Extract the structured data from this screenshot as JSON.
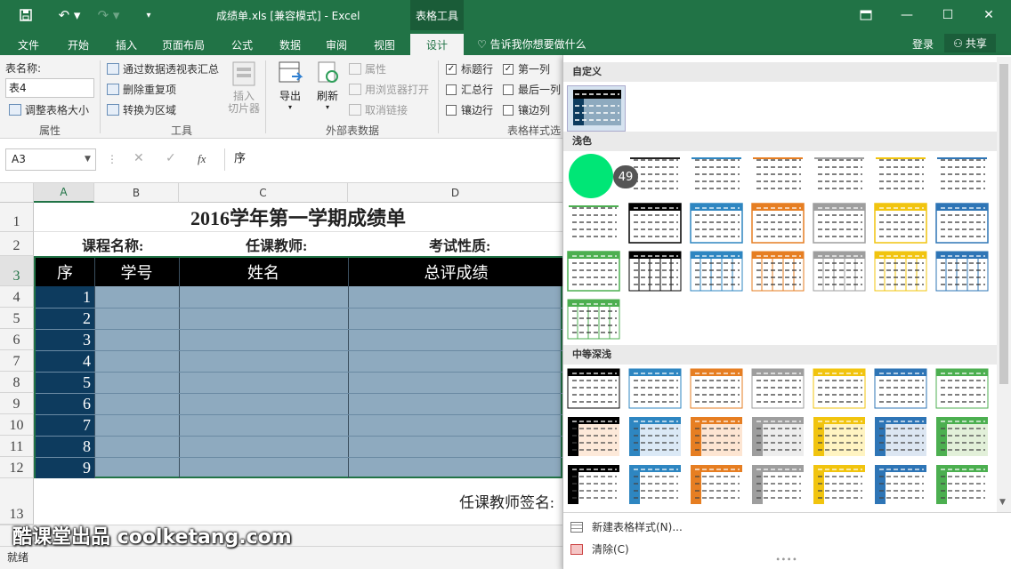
{
  "titlebar": {
    "title": "成绩单.xls  [兼容模式] - Excel",
    "context_tab": "表格工具",
    "share": "共享",
    "login": "登录"
  },
  "tabs": [
    "文件",
    "开始",
    "插入",
    "页面布局",
    "公式",
    "数据",
    "审阅",
    "视图",
    "设计"
  ],
  "tell_me": "告诉我你想要做什么",
  "ribbon": {
    "table_name_label": "表名称:",
    "table_name_value": "表4",
    "resize": "调整表格大小",
    "props_group": "属性",
    "pivot": "通过数据透视表汇总",
    "dedupe": "删除重复项",
    "convert": "转换为区域",
    "slicer": "插入\n切片器",
    "tools_group": "工具",
    "export": "导出",
    "refresh": "刷新",
    "properties": "属性",
    "open_browser": "用浏览器打开",
    "unlink": "取消链接",
    "external_group": "外部表数据",
    "header_row": "标题行",
    "first_col": "第一列",
    "total_row": "汇总行",
    "last_col": "最后一列",
    "banded_rows": "镶边行",
    "banded_cols": "镶边列",
    "style_opts_group": "表格样式选"
  },
  "formula": {
    "namebox": "A3",
    "fx": "fx",
    "value": "序"
  },
  "columns": [
    "A",
    "B",
    "C",
    "D"
  ],
  "sheet": {
    "title": "2016学年第一学期成绩单",
    "course_label": "课程名称:",
    "teacher_label": "任课教师:",
    "exam_label": "考试性质:",
    "headers": [
      "序",
      "学号",
      "姓名",
      "总评成绩"
    ],
    "seq": [
      "1",
      "2",
      "3",
      "4",
      "5",
      "6",
      "7",
      "8",
      "9"
    ],
    "rows": [
      "1",
      "2",
      "3",
      "4",
      "5",
      "6",
      "7",
      "8",
      "9",
      "10",
      "11",
      "12",
      "13"
    ],
    "sign": "任课教师签名:"
  },
  "gallery": {
    "custom": "自定义",
    "light": "浅色",
    "medium": "中等深浅",
    "new_style": "新建表格样式(N)...",
    "clear": "清除(C)",
    "hover_badge": "49"
  },
  "status": {
    "ready": "就绪"
  },
  "watermark": "酷课堂出品 coolketang.com",
  "colors": {
    "excel_green": "#217346",
    "table_dark": "#0d3b5e",
    "table_body": "#8eaabf",
    "header_black": "#000000"
  }
}
